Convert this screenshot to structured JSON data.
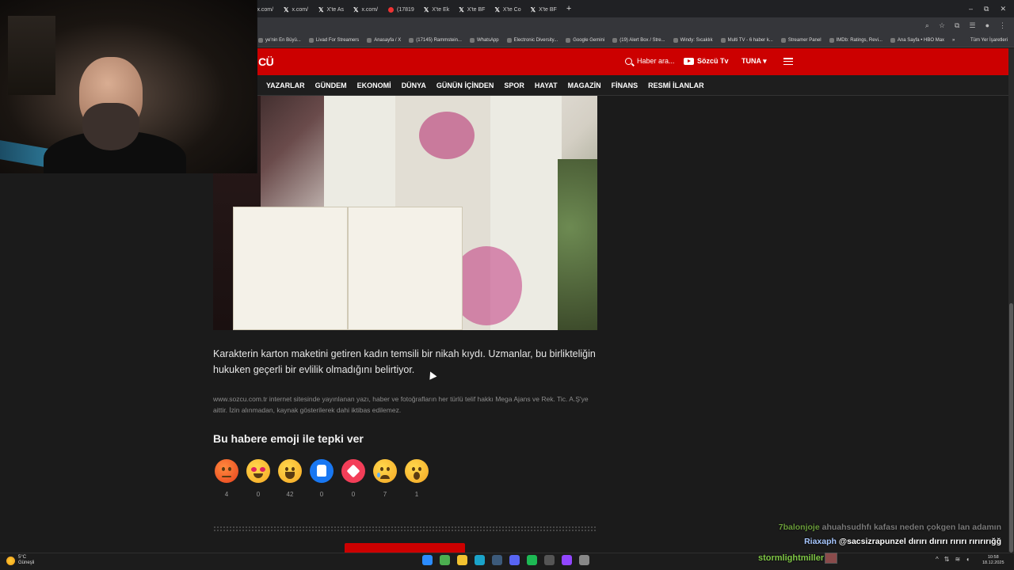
{
  "browser": {
    "tabs": [
      {
        "label": "x.com/",
        "kind": "x"
      },
      {
        "label": "x.com/",
        "kind": "x"
      },
      {
        "label": "x.com/",
        "kind": "x"
      },
      {
        "label": "x.com/",
        "kind": "x"
      },
      {
        "label": "x.com/",
        "kind": "x"
      },
      {
        "label": "x.com/",
        "kind": "x"
      },
      {
        "label": "x.com/",
        "kind": "x"
      },
      {
        "label": "x.com/",
        "kind": "x"
      },
      {
        "label": "x.com/",
        "kind": "x"
      },
      {
        "label": "X'te As",
        "kind": "x"
      },
      {
        "label": "x.com/",
        "kind": "x"
      },
      {
        "label": "(17819",
        "kind": "yt"
      },
      {
        "label": "X'te Ek",
        "kind": "x"
      },
      {
        "label": "X'te BF",
        "kind": "x"
      },
      {
        "label": "X'te Co",
        "kind": "x"
      },
      {
        "label": "X'te BF",
        "kind": "x"
      }
    ],
    "new_tab": "+",
    "window_controls": [
      "–",
      "⧉",
      "✕"
    ],
    "bookmarks": [
      "ye'nin En Büyü...",
      "Livad For Streamers",
      "Anasayfa / X",
      "(17145) Rammstein...",
      "WhatsApp",
      "Electronic Diversity...",
      "Google Gemini",
      "(19) Alert Box / Stre...",
      "Windy: Sıcaklık",
      "Multi TV - 6 haber k...",
      "Streamer Panel",
      "IMDb: Ratings, Revi...",
      "Ana Sayfa • HBO Max"
    ],
    "bookmarks_more": "»",
    "all_bookmarks": "Tüm Yer İşaretleri"
  },
  "site": {
    "logo": "CÜ",
    "search_placeholder": "Haber ara...",
    "tv_label": "Sözcü Tv",
    "user_label": "TUNA ▾",
    "nav": [
      "YAZARLAR",
      "GÜNDEM",
      "EKONOMİ",
      "DÜNYA",
      "GÜNÜN İÇİNDEN",
      "SPOR",
      "HAYAT",
      "MAGAZİN",
      "FİNANS",
      "RESMİ İLANLAR"
    ]
  },
  "article": {
    "caption": "Karakterin karton maketini getiren kadın temsili bir nikah kıydı. Uzmanlar, bu birlikteliğin hukuken geçerli bir evlilik olmadığını belirtiyor.",
    "copyright": "www.sozcu.com.tr internet sitesinde yayınlanan yazı, haber ve fotoğrafların her türlü telif hakkı Mega Ajans ve Rek. Tic. A.Ş'ye aittir. İzin alınmadan, kaynak gösterilerek dahi iktibas edilemez.",
    "reaction_title": "Bu habere emoji ile tepki ver",
    "reactions": [
      {
        "name": "angry",
        "count": "4"
      },
      {
        "name": "love",
        "count": "0"
      },
      {
        "name": "laugh",
        "count": "42"
      },
      {
        "name": "like",
        "count": "0"
      },
      {
        "name": "heart",
        "count": "0"
      },
      {
        "name": "sad",
        "count": "7"
      },
      {
        "name": "wow",
        "count": "1"
      }
    ]
  },
  "chat": {
    "line1_user": "7balonjoje",
    "line1_msg": "ahuahsudhfı kafası neden çokgen lan adamın",
    "line2_user": "Riaxaph",
    "line2_msg": "@sacsizrapunzel dırırı dırırı rırırı rırırırığğ",
    "line3_user": "stormlightmiller"
  },
  "taskbar": {
    "weather_temp": "5°C",
    "weather_desc": "Güneşli",
    "time": "10:58",
    "date": "18.12.2025",
    "apps": [
      {
        "name": "windows-start-icon",
        "color": "#2b8cff"
      },
      {
        "name": "chrome-icon",
        "color": "#4caf50"
      },
      {
        "name": "file-explorer-icon",
        "color": "#f2c230"
      },
      {
        "name": "edge-icon",
        "color": "#1aa3c9"
      },
      {
        "name": "steam-icon",
        "color": "#3c5a7a"
      },
      {
        "name": "discord-icon",
        "color": "#5865f2"
      },
      {
        "name": "spotify-icon",
        "color": "#1db954"
      },
      {
        "name": "obs-icon",
        "color": "#555555"
      },
      {
        "name": "twitch-icon",
        "color": "#9146ff"
      },
      {
        "name": "settings-icon",
        "color": "#888888"
      }
    ]
  }
}
